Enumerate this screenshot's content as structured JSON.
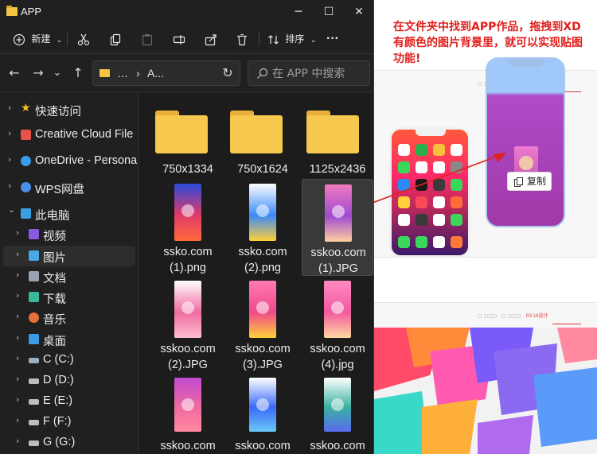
{
  "window": {
    "title": "APP",
    "min_glyph": "─",
    "max_glyph": "☐",
    "close_glyph": "✕"
  },
  "commandbar": {
    "new_label": "新建",
    "sort_label": "排序",
    "more_glyph": "···"
  },
  "address": {
    "back_glyph": "←",
    "forward_glyph": "→",
    "recent_glyph": "⌄",
    "up_glyph": "↑",
    "ellipsis": "…",
    "separator": "›",
    "current": "A...",
    "refresh_glyph": "↻",
    "search_placeholder": "在 APP 中搜索"
  },
  "sidebar": {
    "items": [
      {
        "label": "快速访问",
        "icon": "star-icon",
        "color": "#f5c518"
      },
      {
        "label": "Creative Cloud File",
        "icon": "creative-cloud-icon",
        "color": "#e8504a"
      },
      {
        "label": "OneDrive - Persona",
        "icon": "cloud-icon",
        "color": "#3a9be8"
      },
      {
        "label": "WPS网盘",
        "icon": "wps-cloud-icon",
        "color": "#4a8fe8"
      },
      {
        "label": "此电脑",
        "icon": "computer-icon",
        "color": "#3aa0e0"
      },
      {
        "label": "视频",
        "icon": "video-icon",
        "color": "#8a5ae0"
      },
      {
        "label": "图片",
        "icon": "picture-icon",
        "color": "#4aa8e8"
      },
      {
        "label": "文档",
        "icon": "document-icon",
        "color": "#9aa4b0"
      },
      {
        "label": "下载",
        "icon": "download-icon",
        "color": "#3ab89a"
      },
      {
        "label": "音乐",
        "icon": "music-icon",
        "color": "#e8703a"
      },
      {
        "label": "桌面",
        "icon": "desktop-icon",
        "color": "#3a9be8"
      },
      {
        "label": "C (C:)",
        "icon": "drive-icon",
        "color": "#9ab0c0"
      },
      {
        "label": "D (D:)",
        "icon": "drive-icon",
        "color": "#bdbdbd"
      },
      {
        "label": "E (E:)",
        "icon": "drive-icon",
        "color": "#bdbdbd"
      },
      {
        "label": "F (F:)",
        "icon": "drive-icon",
        "color": "#bdbdbd"
      },
      {
        "label": "G (G:)",
        "icon": "drive-icon",
        "color": "#bdbdbd"
      }
    ]
  },
  "files": [
    {
      "line1": "750x1334",
      "line2": "",
      "kind": "folder"
    },
    {
      "line1": "750x1624",
      "line2": "",
      "kind": "folder"
    },
    {
      "line1": "1125x2436",
      "line2": "",
      "kind": "folder"
    },
    {
      "line1": "ssko.com",
      "line2": "(1).png",
      "kind": "image"
    },
    {
      "line1": "ssko.com",
      "line2": "(2).png",
      "kind": "image"
    },
    {
      "line1": "sskoo.com",
      "line2": "(1).JPG",
      "kind": "image"
    },
    {
      "line1": "sskoo.com",
      "line2": "(2).JPG",
      "kind": "image"
    },
    {
      "line1": "sskoo.com",
      "line2": "(3).JPG",
      "kind": "image"
    },
    {
      "line1": "sskoo.com",
      "line2": "(4).jpg",
      "kind": "image"
    },
    {
      "line1": "sskoo.com",
      "line2": "",
      "kind": "image"
    },
    {
      "line1": "sskoo.com",
      "line2": "",
      "kind": "image"
    },
    {
      "line1": "sskoo.com",
      "line2": "",
      "kind": "image"
    }
  ],
  "annotation": {
    "text": "在文件夹中找到APP作品，拖拽到XD有颜色的图片背景里，就可以实现贴图功能!"
  },
  "context_menu": {
    "copy_label": "复制"
  },
  "design_tabs": {
    "active": "03 UI设计"
  },
  "colors": {
    "accent_red": "#e0201c",
    "folder_yellow": "#f6c84d",
    "explorer_bg": "#202020"
  }
}
